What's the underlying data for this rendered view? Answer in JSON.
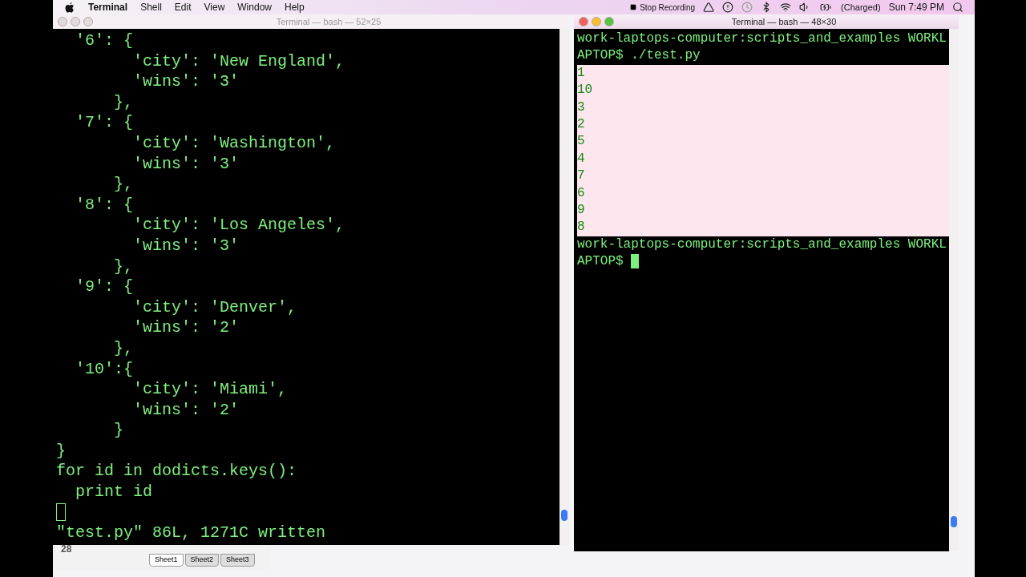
{
  "menu_bar": {
    "app_name": "Terminal",
    "menus": [
      "Shell",
      "Edit",
      "View",
      "Window",
      "Help"
    ],
    "recording": "Stop Recording",
    "battery": "(Charged)",
    "clock": "Sun 7:49 PM"
  },
  "windows": [
    {
      "title": "Terminal — bash — 52×25",
      "active": false,
      "lines": [
        {
          "text": "  '6': {",
          "selected": false
        },
        {
          "text": "        'city': 'New England',",
          "selected": false
        },
        {
          "text": "        'wins': '3'",
          "selected": false
        },
        {
          "text": "      },",
          "selected": false
        },
        {
          "text": "  '7': {",
          "selected": false
        },
        {
          "text": "        'city': 'Washington',",
          "selected": false
        },
        {
          "text": "        'wins': '3'",
          "selected": false
        },
        {
          "text": "      },",
          "selected": false
        },
        {
          "text": "  '8': {",
          "selected": false
        },
        {
          "text": "        'city': 'Los Angeles',",
          "selected": false
        },
        {
          "text": "        'wins': '3'",
          "selected": false
        },
        {
          "text": "      },",
          "selected": false
        },
        {
          "text": "  '9': {",
          "selected": false
        },
        {
          "text": "        'city': 'Denver',",
          "selected": false
        },
        {
          "text": "        'wins': '2'",
          "selected": false
        },
        {
          "text": "      },",
          "selected": false
        },
        {
          "text": "  '10':{",
          "selected": false
        },
        {
          "text": "        'city': 'Miami',",
          "selected": false
        },
        {
          "text": "        'wins': '2'",
          "selected": false
        },
        {
          "text": "      }",
          "selected": false
        },
        {
          "text": "}",
          "selected": false
        },
        {
          "text": "for id in dodicts.keys():",
          "selected": false
        },
        {
          "text": "  print id",
          "selected": false
        },
        {
          "cursor": true,
          "selected": false
        },
        {
          "text": "\"test.py\" 86L, 1271C written",
          "selected": false
        }
      ]
    },
    {
      "title": "Terminal — bash — 48×30",
      "active": true,
      "lines": [
        {
          "text": "work-laptops-computer:scripts_and_examples WORKL",
          "selected": false
        },
        {
          "text": "APTOP$ ./test.py",
          "selected": false
        },
        {
          "text": "1",
          "selected": true
        },
        {
          "text": "10",
          "selected": true
        },
        {
          "text": "3",
          "selected": true
        },
        {
          "text": "2",
          "selected": true
        },
        {
          "text": "5",
          "selected": true
        },
        {
          "text": "4",
          "selected": true
        },
        {
          "text": "7",
          "selected": true
        },
        {
          "text": "6",
          "selected": true
        },
        {
          "text": "9",
          "selected": true
        },
        {
          "text": "8",
          "selected": true
        },
        {
          "text": "work-laptops-computer:scripts_and_examples WORKL",
          "selected": false
        },
        {
          "text": "APTOP$ ",
          "cursor": true,
          "selected": false
        }
      ]
    }
  ],
  "spreadsheet": {
    "row_number": "28",
    "sheets": [
      {
        "label": "Sheet1",
        "selected": true
      },
      {
        "label": "Sheet2",
        "selected": false
      },
      {
        "label": "Sheet3",
        "selected": false
      }
    ]
  }
}
